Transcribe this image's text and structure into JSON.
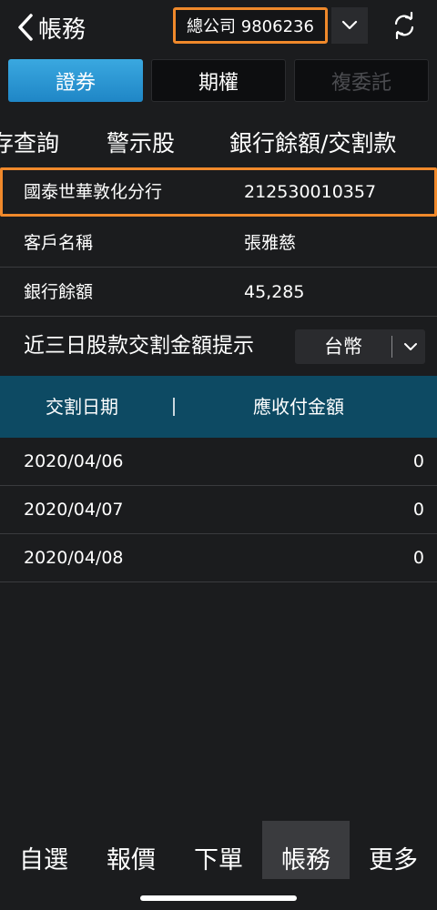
{
  "header": {
    "title": "帳務",
    "account": "總公司 9806236",
    "colors": {
      "highlight_border": "#f0892b",
      "background": "#1b1c1e"
    }
  },
  "segments": [
    {
      "label": "證券",
      "state": "active"
    },
    {
      "label": "期權",
      "state": "normal"
    },
    {
      "label": "複委託",
      "state": "disabled"
    }
  ],
  "subtabs": [
    "存查詢",
    "警示股",
    "銀行餘額/交割款"
  ],
  "info_rows": [
    {
      "label": "國泰世華敦化分行",
      "value": "212530010357"
    },
    {
      "label": "客戶名稱",
      "value": "張雅慈"
    },
    {
      "label": "銀行餘額",
      "value": "45,285"
    }
  ],
  "settlement": {
    "title": "近三日股款交割金額提示",
    "currency": "台幣",
    "columns": [
      "交割日期",
      "應收付金額"
    ],
    "rows": [
      {
        "date": "2020/04/06",
        "amount": "0"
      },
      {
        "date": "2020/04/07",
        "amount": "0"
      },
      {
        "date": "2020/04/08",
        "amount": "0"
      }
    ],
    "header_color": "#0d4a63"
  },
  "bottom_nav": [
    {
      "label": "自選",
      "active": false
    },
    {
      "label": "報價",
      "active": false
    },
    {
      "label": "下單",
      "active": false
    },
    {
      "label": "帳務",
      "active": true
    },
    {
      "label": "更多",
      "active": false
    }
  ],
  "icons": [
    "back-chevron-icon",
    "chevron-down-icon",
    "refresh-icon"
  ]
}
